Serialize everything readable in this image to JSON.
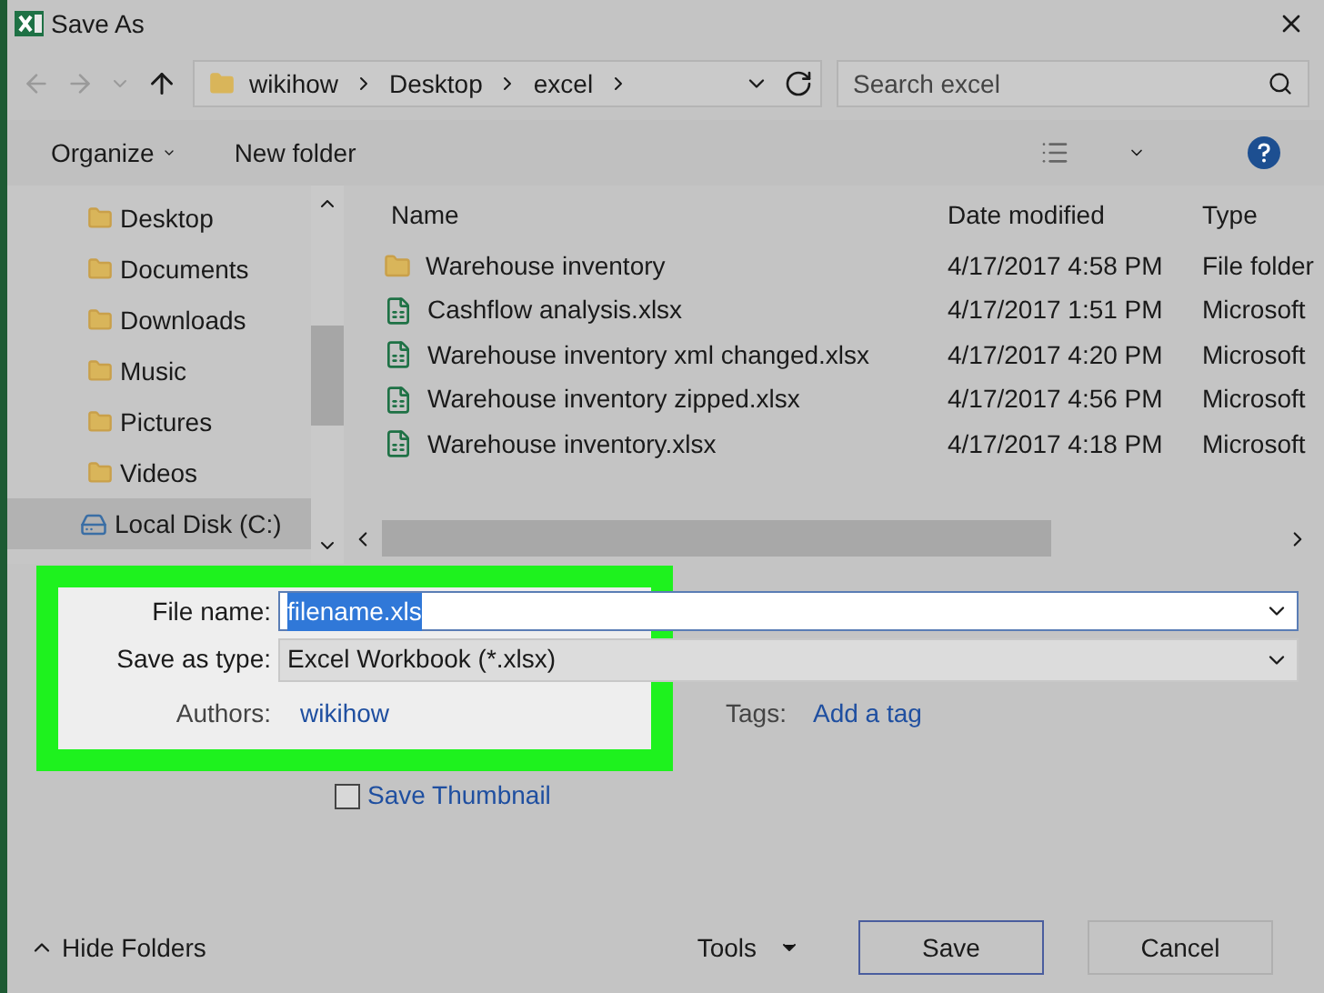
{
  "window": {
    "title": "Save As"
  },
  "nav": {
    "path": [
      "wikihow",
      "Desktop",
      "excel"
    ],
    "search_placeholder": "Search excel"
  },
  "toolbar": {
    "organize": "Organize",
    "new_folder": "New folder"
  },
  "sidebar": {
    "items": [
      {
        "label": "Desktop",
        "selected": false
      },
      {
        "label": "Documents",
        "selected": false
      },
      {
        "label": "Downloads",
        "selected": false
      },
      {
        "label": "Music",
        "selected": false
      },
      {
        "label": "Pictures",
        "selected": false
      },
      {
        "label": "Videos",
        "selected": false
      },
      {
        "label": "Local Disk (C:)",
        "selected": true,
        "kind": "drive"
      }
    ]
  },
  "table": {
    "columns": [
      "Name",
      "Date modified",
      "Type"
    ],
    "rows": [
      {
        "kind": "folder",
        "name": "Warehouse inventory",
        "date": "4/17/2017 4:58 PM",
        "type": "File folder"
      },
      {
        "kind": "excel",
        "name": "Cashflow analysis.xlsx",
        "date": "4/17/2017 1:51 PM",
        "type": "Microsoft"
      },
      {
        "kind": "excel",
        "name": "Warehouse inventory xml changed.xlsx",
        "date": "4/17/2017 4:20 PM",
        "type": "Microsoft"
      },
      {
        "kind": "excel",
        "name": "Warehouse inventory zipped.xlsx",
        "date": "4/17/2017 4:56 PM",
        "type": "Microsoft"
      },
      {
        "kind": "excel",
        "name": "Warehouse inventory.xlsx",
        "date": "4/17/2017 4:18 PM",
        "type": "Microsoft"
      }
    ]
  },
  "form": {
    "file_name_label": "File name:",
    "file_name": "filename.xls",
    "save_type_label": "Save as type:",
    "save_type": "Excel Workbook (*.xlsx)",
    "authors_label": "Authors:",
    "authors": "wikihow",
    "tags_label": "Tags:",
    "tags": "Add a tag",
    "save_thumbnail": {
      "label": "Save Thumbnail",
      "checked": false
    }
  },
  "footer": {
    "hide_folders": "Hide Folders",
    "tools": "Tools",
    "save": "Save",
    "cancel": "Cancel"
  }
}
